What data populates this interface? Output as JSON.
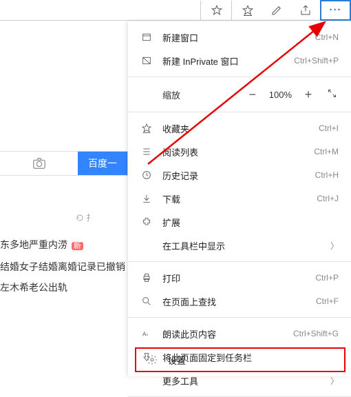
{
  "toolbar": {
    "more_label": "···"
  },
  "search": {
    "button": "百度一"
  },
  "refresh": "扌",
  "news": {
    "items": [
      {
        "text": "东多地严重内涝",
        "badge": "新"
      },
      {
        "text": "结婚女子结婚离婚记录已撤销"
      },
      {
        "text": "左木希老公出轨"
      }
    ]
  },
  "menu": {
    "new_window": {
      "label": "新建窗口",
      "shortcut": "Ctrl+N"
    },
    "new_inprivate": {
      "label": "新建 InPrivate 窗口",
      "shortcut": "Ctrl+Shift+P"
    },
    "zoom": {
      "label": "缩放",
      "value": "100%"
    },
    "favorites": {
      "label": "收藏夹",
      "shortcut": "Ctrl+I"
    },
    "reading_list": {
      "label": "阅读列表",
      "shortcut": "Ctrl+M"
    },
    "history": {
      "label": "历史记录",
      "shortcut": "Ctrl+H"
    },
    "downloads": {
      "label": "下载",
      "shortcut": "Ctrl+J"
    },
    "extensions": {
      "label": "扩展"
    },
    "show_toolbar": {
      "label": "在工具栏中显示"
    },
    "print": {
      "label": "打印",
      "shortcut": "Ctrl+P"
    },
    "find": {
      "label": "在页面上查找",
      "shortcut": "Ctrl+F"
    },
    "read_aloud": {
      "label": "朗读此页内容",
      "shortcut": "Ctrl+Shift+G"
    },
    "pin_taskbar": {
      "label": "将此页面固定到任务栏"
    },
    "more_tools": {
      "label": "更多工具"
    },
    "settings": {
      "label": "设置"
    }
  }
}
